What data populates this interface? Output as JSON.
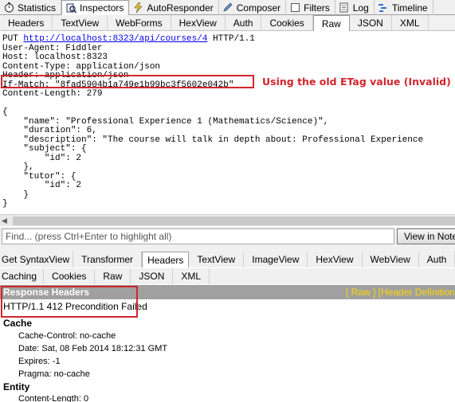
{
  "main_tabs": [
    {
      "label": "Statistics",
      "icon": "stopwatch-icon"
    },
    {
      "label": "Inspectors",
      "icon": "magnifier-icon",
      "active": true
    },
    {
      "label": "AutoResponder",
      "icon": "lightning-icon"
    },
    {
      "label": "Composer",
      "icon": "pencil-icon"
    },
    {
      "label": "Filters",
      "icon": "checkbox-icon"
    },
    {
      "label": "Log",
      "icon": "document-icon"
    },
    {
      "label": "Timeline",
      "icon": "timeline-icon"
    }
  ],
  "request_tabs": [
    "Headers",
    "TextView",
    "WebForms",
    "HexView",
    "Auth",
    "Cookies",
    "Raw",
    "JSON",
    "XML"
  ],
  "request_active_tab": "Raw",
  "request": {
    "method": "PUT",
    "url": "http://localhost:8323/api/courses/4",
    "protocol": "HTTP/1.1",
    "user_agent": "User-Agent: Fiddler",
    "host": "Host: localhost:8323",
    "content_type": "Content-Type: application/json",
    "header_partial": "Header: application/json",
    "if_match": "If-Match: \"8fad5904b1a749e1b99bc3f5602e042b\"",
    "content_length": "Content-Length: 279",
    "body": "{\n    \"name\": \"Professional Experience 1 (Mathematics/Science)\",\n    \"duration\": 6,\n    \"description\": \"The course will talk in depth about: Professional Experience\n    \"subject\": {\n        \"id\": 2\n    },\n    \"tutor\": {\n        \"id\": 2\n    }\n}"
  },
  "annotation": "Using the old ETag value (Invalid)",
  "find": {
    "placeholder": "Find... (press Ctrl+Enter to highlight all)",
    "button_label": "View in Notepad"
  },
  "response_tabs_row1": [
    "Get SyntaxView",
    "Transformer",
    "Headers",
    "TextView",
    "ImageView",
    "HexView",
    "WebView",
    "Auth"
  ],
  "response_tabs_row2": [
    "Caching",
    "Cookies",
    "Raw",
    "JSON",
    "XML"
  ],
  "response_active_tab": "Headers",
  "response": {
    "title": "Response Headers",
    "links": "[ Raw ]    [Header Definitions]",
    "status_line": "HTTP/1.1 412 Precondition Failed",
    "sections": [
      {
        "name": "Cache",
        "lines": [
          "Cache-Control: no-cache",
          "Date: Sat, 08 Feb 2014 18:12:31 GMT",
          "Expires: -1",
          "Pragma: no-cache"
        ]
      },
      {
        "name": "Entity",
        "lines": [
          "Content-Length: 0"
        ]
      }
    ]
  }
}
